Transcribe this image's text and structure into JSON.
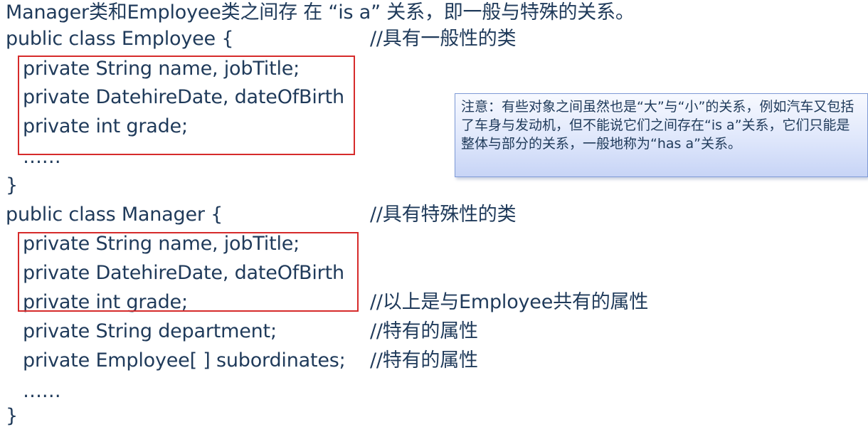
{
  "heading": "Manager类和Employee类之间存 在 “is a” 关系，即一般与特殊的关系。",
  "employee_class": {
    "decl": "public class Employee {",
    "comment": "//具有一般性的类",
    "fields": [
      "private String name, jobTitle;",
      "private DatehireDate, dateOfBirth",
      "private int grade;"
    ],
    "ellipsis": "……",
    "close": "}"
  },
  "manager_class": {
    "decl": "public class Manager {",
    "comment": "//具有特殊性的类",
    "fields": [
      "private String name, jobTitle;",
      "private DatehireDate, dateOfBirth",
      "private int grade;",
      "private String department;",
      "private Employee[ ] subordinates;"
    ],
    "field_comments": {
      "grade": "//以上是与Employee共有的属性",
      "department": "//特有的属性",
      "subordinates": "//特有的属性"
    },
    "ellipsis": "……",
    "close": "}"
  },
  "note": {
    "text": "注意：有些对象之间虽然也是“大”与“小”的关系，例如汽车又包括了车身与发动机，但不能说它们之间存在“is a”关系，它们只能是整体与部分的关系，一般地称为“has a”关系。"
  },
  "colors": {
    "text": "#1f3a5a",
    "highlight_box": "#d62b2b",
    "note_border": "#7e9ad6",
    "note_fill_top": "#f7f9ff",
    "note_fill_bottom": "#c7d4f6"
  }
}
